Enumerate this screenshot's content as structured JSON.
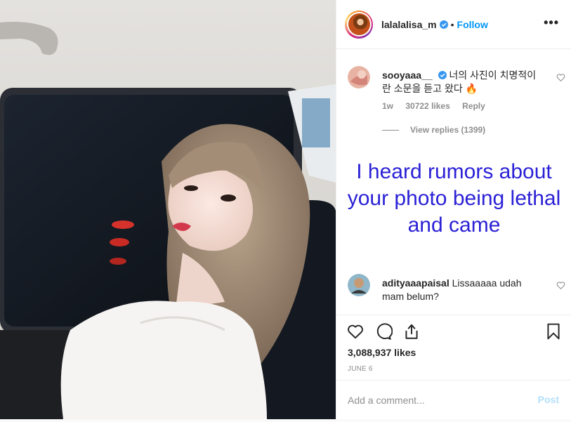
{
  "post": {
    "username": "lalalalisa_m",
    "dot": "•",
    "follow_label": "Follow",
    "more_label": "•••",
    "likes": "3,088,937 likes",
    "date": "JUNE 6"
  },
  "comments": [
    {
      "username": "sooyaaa__",
      "text": "너의 사진이 치명적이란 소문을 듣고 왔다 🔥",
      "time": "1w",
      "likes": "30722 likes",
      "reply_label": "Reply",
      "view_replies": "View replies (1399)"
    },
    {
      "username": "adityaaapaisal",
      "text": "Lissaaaaa udah mam belum?"
    }
  ],
  "overlay_caption": "I heard rumors about your photo being lethal and came",
  "add_comment": {
    "placeholder": "Add a comment...",
    "post_label": "Post"
  },
  "colors": {
    "accent": "#0095f6",
    "overlay_text": "#2b21d6",
    "post_disabled": "#b2dffc"
  }
}
